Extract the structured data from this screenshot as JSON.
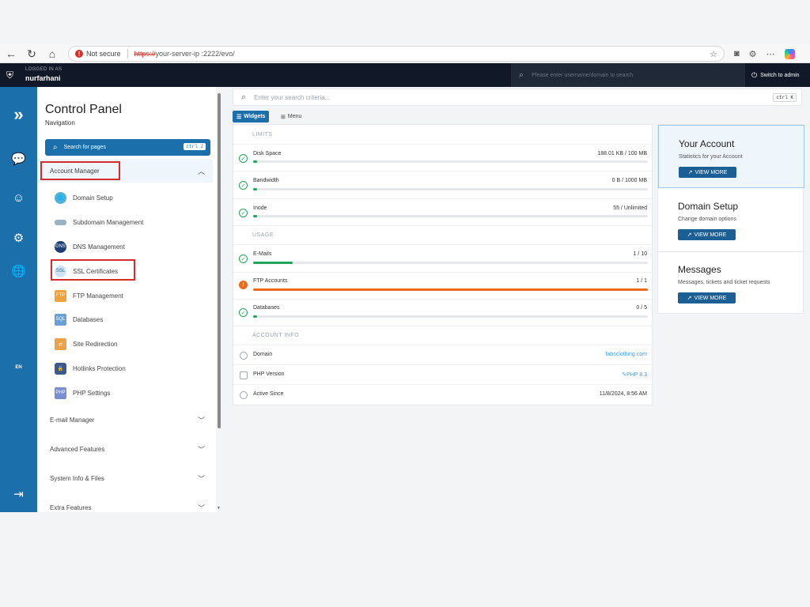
{
  "browser": {
    "back_icon": "←",
    "refresh_icon": "↻",
    "home_icon": "⌂",
    "not_secure_label": "Not secure",
    "url_protocol": "https://",
    "url_rest": " your-server-ip :2222/evo/"
  },
  "topbar": {
    "logged_in_label": "LOGGED IN AS",
    "username": "nurfarhani",
    "search_placeholder": "Please enter username/domain to search",
    "switch_admin_label": "Switch to admin"
  },
  "rail": {
    "language": "EN"
  },
  "nav": {
    "title": "Control Panel",
    "subtitle": "Navigation",
    "search_button": "Search for pages",
    "search_shortcut": "ctrl J",
    "sections": [
      {
        "label": "Account Manager",
        "expanded": true
      },
      {
        "label": "E-mail Manager",
        "expanded": false
      },
      {
        "label": "Advanced Features",
        "expanded": false
      },
      {
        "label": "System Info & Files",
        "expanded": false
      },
      {
        "label": "Extra Features",
        "expanded": false
      }
    ],
    "items": [
      {
        "label": "Domain Setup",
        "icon": "globe-icon"
      },
      {
        "label": "Subdomain Management",
        "icon": "subdomain-icon"
      },
      {
        "label": "DNS Management",
        "icon": "dns-icon"
      },
      {
        "label": "SSL Certificates",
        "icon": "ssl-icon"
      },
      {
        "label": "FTP Management",
        "icon": "ftp-icon"
      },
      {
        "label": "Databases",
        "icon": "database-icon"
      },
      {
        "label": "Site Redirection",
        "icon": "signpost-icon"
      },
      {
        "label": "Hotlinks Protection",
        "icon": "lock-icon"
      },
      {
        "label": "PHP Settings",
        "icon": "php-icon"
      }
    ],
    "highlighted": [
      "Account Manager",
      "SSL Certificates"
    ]
  },
  "main": {
    "search_placeholder": "Enter your search criteria...",
    "search_shortcut": "ctrl K",
    "tabs": [
      {
        "label": "Widgets",
        "active": true
      },
      {
        "label": "Menu",
        "active": false
      }
    ],
    "limits_label": "LIMITS",
    "usage_label": "USAGE",
    "account_info_label": "ACCOUNT INFO",
    "limits": [
      {
        "name": "Disk Space",
        "value": "188.01 KB / 100 MB",
        "fill": 0.01,
        "status": "ok"
      },
      {
        "name": "Bandwidth",
        "value": "0 B / 1000 MB",
        "fill": 0.01,
        "status": "ok"
      },
      {
        "name": "Inode",
        "value": "55 / Unlimited",
        "fill": 0.01,
        "status": "ok"
      }
    ],
    "usage": [
      {
        "name": "E-Mails",
        "value": "1 / 10",
        "fill": 0.1,
        "status": "ok"
      },
      {
        "name": "FTP Accounts",
        "value": "1 / 1",
        "fill": 1.0,
        "status": "warn"
      },
      {
        "name": "Databases",
        "value": "0 / 5",
        "fill": 0.01,
        "status": "ok"
      }
    ],
    "account_info": [
      {
        "name": "Domain",
        "value": "fabsclothing.com",
        "link": true
      },
      {
        "name": "PHP Version",
        "value": "PHP 8.3",
        "link": true
      },
      {
        "name": "Active Since",
        "value": "11/8/2024, 8:56 AM",
        "link": false
      }
    ]
  },
  "side_cards": [
    {
      "title": "Your Account",
      "desc": "Statistics for your Account",
      "button": "VIEW MORE",
      "active": true
    },
    {
      "title": "Domain Setup",
      "desc": "Change domain options",
      "button": "VIEW MORE",
      "active": false
    },
    {
      "title": "Messages",
      "desc": "Messages, tickets and ticket requests",
      "button": "VIEW MORE",
      "active": false
    }
  ],
  "colors": {
    "brand": "#1b6fab",
    "ok": "#22a55a",
    "warn": "#ea6a1f",
    "highlight": "#d42b2b"
  }
}
